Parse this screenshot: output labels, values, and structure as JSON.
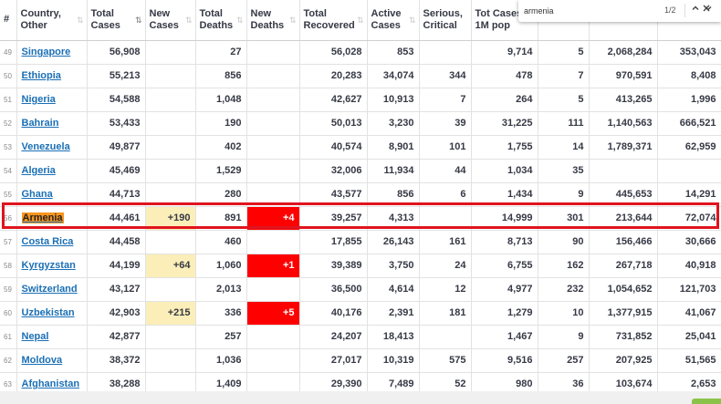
{
  "headers": {
    "rank": "#",
    "country": [
      "Country,",
      "Other"
    ],
    "total_cases": [
      "Total",
      "Cases"
    ],
    "new_cases": [
      "New",
      "Cases"
    ],
    "total_deaths": [
      "Total",
      "Deaths"
    ],
    "new_deaths": [
      "New",
      "Deaths"
    ],
    "total_recovered": [
      "Total",
      "Recovered"
    ],
    "active_cases": [
      "Active",
      "Cases"
    ],
    "serious_critical": [
      "Serious,",
      "Critical"
    ],
    "tot_cases_1m": [
      "Tot Cases/",
      "1M pop"
    ],
    "sort_icon": "⇅"
  },
  "find_bar": {
    "query": "armenia",
    "count": "1/2",
    "prev_icon": "chevron-up-icon",
    "next_icon": "chevron-down-icon",
    "close_icon": "close-icon"
  },
  "highlight_color": "#e0141e",
  "new_cases_color": "#fbeeb8",
  "new_deaths_color": "#ff0000",
  "rows": [
    {
      "rank": "49",
      "country": "Singapore",
      "total_cases": "56,908",
      "new_cases": "",
      "total_deaths": "27",
      "new_deaths": "",
      "recovered": "56,028",
      "active": "853",
      "serious": "",
      "per_million": "9,714",
      "deaths_per_million": "5",
      "total_tests": "2,068,284",
      "tests_per_million": "353,043"
    },
    {
      "rank": "50",
      "country": "Ethiopia",
      "total_cases": "55,213",
      "new_cases": "",
      "total_deaths": "856",
      "new_deaths": "",
      "recovered": "20,283",
      "active": "34,074",
      "serious": "344",
      "per_million": "478",
      "deaths_per_million": "7",
      "total_tests": "970,591",
      "tests_per_million": "8,408"
    },
    {
      "rank": "51",
      "country": "Nigeria",
      "total_cases": "54,588",
      "new_cases": "",
      "total_deaths": "1,048",
      "new_deaths": "",
      "recovered": "42,627",
      "active": "10,913",
      "serious": "7",
      "per_million": "264",
      "deaths_per_million": "5",
      "total_tests": "413,265",
      "tests_per_million": "1,996"
    },
    {
      "rank": "52",
      "country": "Bahrain",
      "total_cases": "53,433",
      "new_cases": "",
      "total_deaths": "190",
      "new_deaths": "",
      "recovered": "50,013",
      "active": "3,230",
      "serious": "39",
      "per_million": "31,225",
      "deaths_per_million": "111",
      "total_tests": "1,140,563",
      "tests_per_million": "666,521"
    },
    {
      "rank": "53",
      "country": "Venezuela",
      "total_cases": "49,877",
      "new_cases": "",
      "total_deaths": "402",
      "new_deaths": "",
      "recovered": "40,574",
      "active": "8,901",
      "serious": "101",
      "per_million": "1,755",
      "deaths_per_million": "14",
      "total_tests": "1,789,371",
      "tests_per_million": "62,959"
    },
    {
      "rank": "54",
      "country": "Algeria",
      "total_cases": "45,469",
      "new_cases": "",
      "total_deaths": "1,529",
      "new_deaths": "",
      "recovered": "32,006",
      "active": "11,934",
      "serious": "44",
      "per_million": "1,034",
      "deaths_per_million": "35",
      "total_tests": "",
      "tests_per_million": ""
    },
    {
      "rank": "55",
      "country": "Ghana",
      "total_cases": "44,713",
      "new_cases": "",
      "total_deaths": "280",
      "new_deaths": "",
      "recovered": "43,577",
      "active": "856",
      "serious": "6",
      "per_million": "1,434",
      "deaths_per_million": "9",
      "total_tests": "445,653",
      "tests_per_million": "14,291"
    },
    {
      "rank": "56",
      "country": "Armenia",
      "total_cases": "44,461",
      "new_cases": "+190",
      "total_deaths": "891",
      "new_deaths": "+4",
      "recovered": "39,257",
      "active": "4,313",
      "serious": "",
      "per_million": "14,999",
      "deaths_per_million": "301",
      "total_tests": "213,644",
      "tests_per_million": "72,074",
      "find_match": true
    },
    {
      "rank": "57",
      "country": "Costa Rica",
      "total_cases": "44,458",
      "new_cases": "",
      "total_deaths": "460",
      "new_deaths": "",
      "recovered": "17,855",
      "active": "26,143",
      "serious": "161",
      "per_million": "8,713",
      "deaths_per_million": "90",
      "total_tests": "156,466",
      "tests_per_million": "30,666"
    },
    {
      "rank": "58",
      "country": "Kyrgyzstan",
      "total_cases": "44,199",
      "new_cases": "+64",
      "total_deaths": "1,060",
      "new_deaths": "+1",
      "recovered": "39,389",
      "active": "3,750",
      "serious": "24",
      "per_million": "6,755",
      "deaths_per_million": "162",
      "total_tests": "267,718",
      "tests_per_million": "40,918"
    },
    {
      "rank": "59",
      "country": "Switzerland",
      "total_cases": "43,127",
      "new_cases": "",
      "total_deaths": "2,013",
      "new_deaths": "",
      "recovered": "36,500",
      "active": "4,614",
      "serious": "12",
      "per_million": "4,977",
      "deaths_per_million": "232",
      "total_tests": "1,054,652",
      "tests_per_million": "121,703"
    },
    {
      "rank": "60",
      "country": "Uzbekistan",
      "total_cases": "42,903",
      "new_cases": "+215",
      "total_deaths": "336",
      "new_deaths": "+5",
      "recovered": "40,176",
      "active": "2,391",
      "serious": "181",
      "per_million": "1,279",
      "deaths_per_million": "10",
      "total_tests": "1,377,915",
      "tests_per_million": "41,067"
    },
    {
      "rank": "61",
      "country": "Nepal",
      "total_cases": "42,877",
      "new_cases": "",
      "total_deaths": "257",
      "new_deaths": "",
      "recovered": "24,207",
      "active": "18,413",
      "serious": "",
      "per_million": "1,467",
      "deaths_per_million": "9",
      "total_tests": "731,852",
      "tests_per_million": "25,041"
    },
    {
      "rank": "62",
      "country": "Moldova",
      "total_cases": "38,372",
      "new_cases": "",
      "total_deaths": "1,036",
      "new_deaths": "",
      "recovered": "27,017",
      "active": "10,319",
      "serious": "575",
      "per_million": "9,516",
      "deaths_per_million": "257",
      "total_tests": "207,925",
      "tests_per_million": "51,565"
    },
    {
      "rank": "63",
      "country": "Afghanistan",
      "total_cases": "38,288",
      "new_cases": "",
      "total_deaths": "1,409",
      "new_deaths": "",
      "recovered": "29,390",
      "active": "7,489",
      "serious": "52",
      "per_million": "980",
      "deaths_per_million": "36",
      "total_tests": "103,674",
      "tests_per_million": "2,653"
    }
  ]
}
